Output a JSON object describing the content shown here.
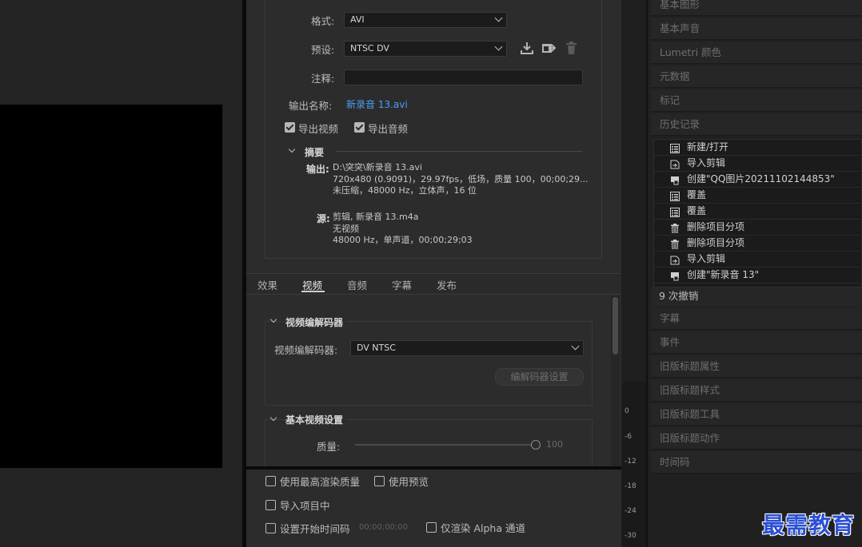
{
  "export": {
    "format_label": "格式:",
    "format_value": "AVI",
    "preset_label": "预设:",
    "preset_value": "NTSC DV",
    "comment_label": "注释:",
    "output_name_label": "输出名称:",
    "output_name_value": "新录音 13.avi",
    "export_video_label": "导出视频",
    "export_audio_label": "导出音频",
    "summary_title": "摘要",
    "output_label": "输出:",
    "output_lines": [
      "D:\\突突\\新录音 13.avi",
      "720x480 (0.9091)，29.97fps，低场，质量 100，00;00;29...",
      "未压缩，48000 Hz，立体声，16 位"
    ],
    "source_label": "源:",
    "source_lines": [
      "剪辑, 新录音 13.m4a",
      "无视频",
      "48000 Hz，单声道，00;00;29;03"
    ]
  },
  "tabs": [
    "效果",
    "视频",
    "音频",
    "字幕",
    "发布"
  ],
  "video": {
    "codec_section_title": "视频编解码器",
    "codec_label": "视频编解码器:",
    "codec_value": "DV NTSC",
    "codec_settings_button": "编解码器设置",
    "basic_section_title": "基本视频设置",
    "quality_label": "质量:",
    "quality_value": "100",
    "quality_fraction": 1.0
  },
  "bottom": {
    "max_render_quality": "使用最高渲染质量",
    "use_previews": "使用预览",
    "import_into_project": "导入项目中",
    "set_start_timecode": "设置开始时间码",
    "start_timecode_value": "00;00;00;00",
    "render_alpha_only": "仅渲染 Alpha 通道"
  },
  "meter": {
    "ticks": [
      "0",
      "-6",
      "-12",
      "-18",
      "-24",
      "-30"
    ]
  },
  "right_panels": {
    "top_headers": [
      "基本图形",
      "基本声音",
      "Lumetri 颜色",
      "元数据",
      "标记",
      "历史记录"
    ],
    "history_items": [
      {
        "icon": "document-list-icon",
        "label": "新建/打开"
      },
      {
        "icon": "import-clip-icon",
        "label": "导入剪辑"
      },
      {
        "icon": "create-clip-icon",
        "label": "创建\"QQ图片20211102144853\""
      },
      {
        "icon": "document-list-icon",
        "label": "覆盖"
      },
      {
        "icon": "document-list-icon",
        "label": "覆盖"
      },
      {
        "icon": "trash-icon",
        "label": "删除项目分项"
      },
      {
        "icon": "trash-icon",
        "label": "删除项目分项"
      },
      {
        "icon": "import-clip-icon",
        "label": "导入剪辑"
      },
      {
        "icon": "create-clip-icon",
        "label": "创建\"新录音 13\""
      }
    ],
    "history_status": "9 次撤销",
    "bottom_headers": [
      "字幕",
      "事件",
      "旧版标题属性",
      "旧版标题样式",
      "旧版标题工具",
      "旧版标题动作",
      "时间码"
    ]
  },
  "watermark": "最需教育"
}
